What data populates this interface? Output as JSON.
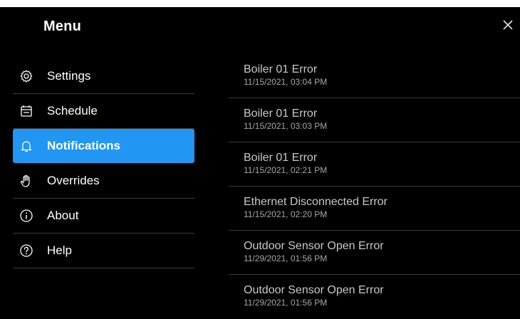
{
  "header": {
    "title": "Menu",
    "close_icon": "close-icon"
  },
  "menu": {
    "active_color": "#2196f3",
    "items": [
      {
        "label": "Settings",
        "icon": "gear-icon"
      },
      {
        "label": "Schedule",
        "icon": "calendar-icon"
      },
      {
        "label": "Notifications",
        "icon": "bell-icon",
        "active": true
      },
      {
        "label": "Overrides",
        "icon": "hand-icon"
      },
      {
        "label": "About",
        "icon": "info-icon"
      },
      {
        "label": "Help",
        "icon": "help-icon"
      }
    ]
  },
  "notifications": [
    {
      "title": "Boiler 01 Error",
      "time": "11/15/2021, 03:04 PM"
    },
    {
      "title": "Boiler 01 Error",
      "time": "11/15/2021, 03:03 PM"
    },
    {
      "title": "Boiler 01 Error",
      "time": "11/15/2021, 02:21 PM"
    },
    {
      "title": "Ethernet Disconnected Error",
      "time": "11/15/2021, 02:20 PM"
    },
    {
      "title": "Outdoor Sensor Open Error",
      "time": "11/29/2021, 01:56 PM"
    },
    {
      "title": "Outdoor Sensor Open Error",
      "time": "11/29/2021, 01:56 PM"
    }
  ]
}
